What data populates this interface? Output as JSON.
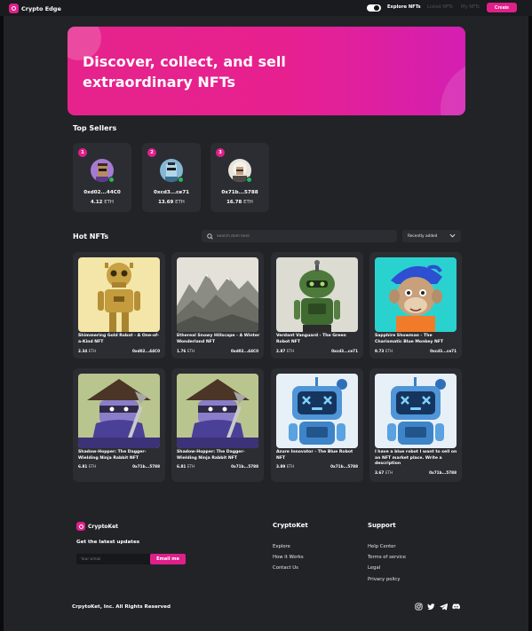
{
  "nav": {
    "brand": "Crypto Edge",
    "links": [
      "Explore NFTs",
      "Listed NFTs",
      "My NFTs"
    ],
    "create_label": "Create"
  },
  "hero": {
    "title_line1": "Discover, collect, and sell",
    "title_line2": "extraordinary NFTs"
  },
  "top_sellers": {
    "title": "Top Sellers",
    "sellers": [
      {
        "rank": "1",
        "address": "0xd02...44C0",
        "amount": "4.12",
        "unit": "ETH",
        "avatar": "punk-avatar"
      },
      {
        "rank": "2",
        "address": "0xcd3...ce71",
        "amount": "13.69",
        "unit": "ETH",
        "avatar": "robot-avatar"
      },
      {
        "rank": "3",
        "address": "0x71b...5788",
        "amount": "16.78",
        "unit": "ETH",
        "avatar": "einstein-avatar"
      }
    ]
  },
  "hot_nfts": {
    "title": "Hot NFTs",
    "search_placeholder": "Search item here",
    "sort_selected": "Recently added",
    "items": [
      {
        "name": "Shimmering Gold Robot - A One-of-a-Kind NFT",
        "price": "2.34",
        "unit": "ETH",
        "owner": "0xd02...44C0",
        "art": "gold-robot"
      },
      {
        "name": "Ethereal Snowy Hillscape - A Winter Wonderland NFT",
        "price": "1.76",
        "unit": "ETH",
        "owner": "0xd02...44C0",
        "art": "snowy-hills"
      },
      {
        "name": "Verdant Vanguard - The Green Robot NFT",
        "price": "2.87",
        "unit": "ETH",
        "owner": "0xcd3...ce71",
        "art": "green-robot"
      },
      {
        "name": "Sapphire Showman - The Charismatic Blue Monkey NFT",
        "price": "9.73",
        "unit": "ETH",
        "owner": "0xcd3...ce71",
        "art": "blue-monkey"
      },
      {
        "name": "Shadow-Hopper: The Dagger-Wielding Ninja Rabbit NFT",
        "price": "6.81",
        "unit": "ETH",
        "owner": "0x71b...5788",
        "art": "ninja-rabbit"
      },
      {
        "name": "Shadow-Hopper: The Dagger-Wielding Ninja Rabbit NFT",
        "price": "6.81",
        "unit": "ETH",
        "owner": "0x71b...5788",
        "art": "ninja-rabbit"
      },
      {
        "name": "Azure Innovator - The Blue Robot NFT",
        "price": "3.89",
        "unit": "ETH",
        "owner": "0x71b...5788",
        "art": "blue-robot"
      },
      {
        "name": "I have a blue robot I want to sell on an NFT market place. Write a description",
        "price": "3.67",
        "unit": "ETH",
        "owner": "0x71b...5788",
        "art": "blue-robot"
      }
    ]
  },
  "footer": {
    "brand": "CryptoKet",
    "newsletter_title": "Get the latest updates",
    "email_placeholder": "Your Email",
    "email_button": "Email me",
    "col1_title": "CryptoKet",
    "col1_links": [
      "Explore",
      "How it Works",
      "Contact Us"
    ],
    "col2_title": "Support",
    "col2_links": [
      "Help Center",
      "Terms of service",
      "Legal",
      "Privacy policy"
    ],
    "copyright": "CrpytoKet, Inc. All Rights Reserved",
    "socials": [
      "instagram-icon",
      "twitter-icon",
      "telegram-icon",
      "discord-icon"
    ]
  },
  "colors": {
    "accent": "#e0208a",
    "background": "#222327",
    "card": "#2c2d32"
  }
}
